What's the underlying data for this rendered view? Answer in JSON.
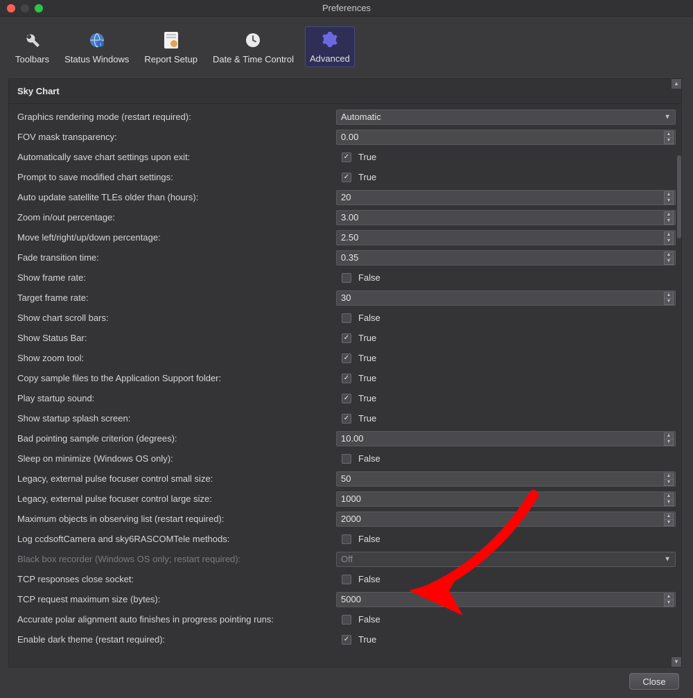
{
  "window": {
    "title": "Preferences"
  },
  "tabs": [
    {
      "label": "Toolbars"
    },
    {
      "label": "Status Windows"
    },
    {
      "label": "Report Setup"
    },
    {
      "label": "Date & Time Control"
    },
    {
      "label": "Advanced"
    }
  ],
  "section": {
    "title": "Sky Chart"
  },
  "rows": [
    {
      "label": "Graphics rendering mode (restart required):",
      "type": "select",
      "value": "Automatic"
    },
    {
      "label": "FOV mask transparency:",
      "type": "num",
      "value": "0.00"
    },
    {
      "label": "Automatically save chart settings upon exit:",
      "type": "check",
      "checked": true,
      "value": "True"
    },
    {
      "label": "Prompt to save modified chart settings:",
      "type": "check",
      "checked": true,
      "value": "True"
    },
    {
      "label": "Auto update satellite TLEs older than (hours):",
      "type": "num",
      "value": "20"
    },
    {
      "label": "Zoom in/out percentage:",
      "type": "num",
      "value": "3.00"
    },
    {
      "label": "Move left/right/up/down percentage:",
      "type": "num",
      "value": "2.50"
    },
    {
      "label": "Fade transition time:",
      "type": "num",
      "value": "0.35"
    },
    {
      "label": "Show frame rate:",
      "type": "check",
      "checked": false,
      "value": "False"
    },
    {
      "label": "Target frame rate:",
      "type": "num",
      "value": "30"
    },
    {
      "label": "Show chart scroll bars:",
      "type": "check",
      "checked": false,
      "value": "False"
    },
    {
      "label": "Show Status Bar:",
      "type": "check",
      "checked": true,
      "value": "True"
    },
    {
      "label": "Show zoom tool:",
      "type": "check",
      "checked": true,
      "value": "True"
    },
    {
      "label": "Copy sample files to the Application Support folder:",
      "type": "check",
      "checked": true,
      "value": "True"
    },
    {
      "label": "Play startup sound:",
      "type": "check",
      "checked": true,
      "value": "True"
    },
    {
      "label": "Show startup splash screen:",
      "type": "check",
      "checked": true,
      "value": "True"
    },
    {
      "label": "Bad pointing sample criterion (degrees):",
      "type": "num",
      "value": "10.00"
    },
    {
      "label": "Sleep on minimize (Windows OS only):",
      "type": "check",
      "checked": false,
      "value": "False"
    },
    {
      "label": "Legacy, external pulse focuser control small size:",
      "type": "num",
      "value": "50"
    },
    {
      "label": "Legacy, external pulse focuser control large size:",
      "type": "num",
      "value": "1000"
    },
    {
      "label": "Maximum objects in observing list (restart required):",
      "type": "num",
      "value": "2000"
    },
    {
      "label": "Log ccdsoftCamera and sky6RASCOMTele methods:",
      "type": "check",
      "checked": false,
      "value": "False"
    },
    {
      "label": "Black box recorder (Windows OS only; restart required):",
      "type": "select",
      "value": "Off",
      "disabled": true
    },
    {
      "label": "TCP responses close socket:",
      "type": "check",
      "checked": false,
      "value": "False"
    },
    {
      "label": "TCP request maximum size (bytes):",
      "type": "num",
      "value": "5000"
    },
    {
      "label": "Accurate polar alignment auto finishes in progress pointing runs:",
      "type": "check",
      "checked": false,
      "value": "False"
    },
    {
      "label": "Enable dark theme (restart required):",
      "type": "check",
      "checked": true,
      "value": "True"
    }
  ],
  "footer": {
    "close": "Close"
  }
}
